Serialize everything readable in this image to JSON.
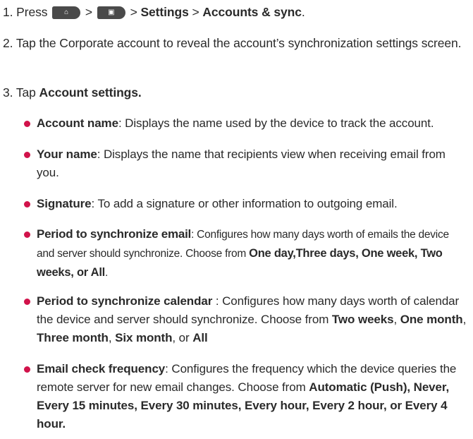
{
  "steps": {
    "s1": {
      "num": "1. Press",
      "gt1": ">",
      "gt2": ">",
      "settings": "Settings",
      "gt3": ">",
      "accounts": "Accounts & sync",
      "end": "."
    },
    "s2": {
      "text": "2. Tap the Corporate account to reveal the account’s synchronization settings screen."
    },
    "s3": {
      "pre": "3. Tap",
      "bold": "Account settings."
    }
  },
  "icons": {
    "home_button": "home-key-icon",
    "menu_button": "menu-key-icon"
  },
  "bullets": [
    {
      "term": "Account name",
      "desc": ": Displays the name used by the device to track the account."
    },
    {
      "term": "Your name",
      "desc": ": Displays the name that recipients view when receiving email from you."
    },
    {
      "term": "Signature",
      "desc": ": To add a signature or other information to outgoing email."
    },
    {
      "term": "Period to synchronize email",
      "desc": ": Configures how many days worth of emails the device and server should synchronize. Choose from ",
      "choices": "One day,Three days, One week, Two weeks, or All",
      "end": "."
    },
    {
      "term": "Period to synchronize calendar",
      "desc": " : Configures how many days worth of calendar the device and server should synchronize. Choose from ",
      "c1": "Two weeks",
      "sep1": ", ",
      "c2": "One month",
      "sep2": ", ",
      "c3": "Three month",
      "sep3": ", ",
      "c4": "Six month",
      "sep4": ", or ",
      "c5": "All"
    },
    {
      "term": "Email check frequency",
      "desc": ": Configures the frequency which the device queries the remote server for new email changes. Choose  from ",
      "choices": "Automatic (Push), Never, Every 15 minutes, Every 30 minutes, Every hour, Every 2 hour, or Every 4 hour."
    }
  ],
  "colors": {
    "bullet": "#d1124a",
    "text": "#2a2a2a",
    "key_icon": "#4a4a4a"
  }
}
